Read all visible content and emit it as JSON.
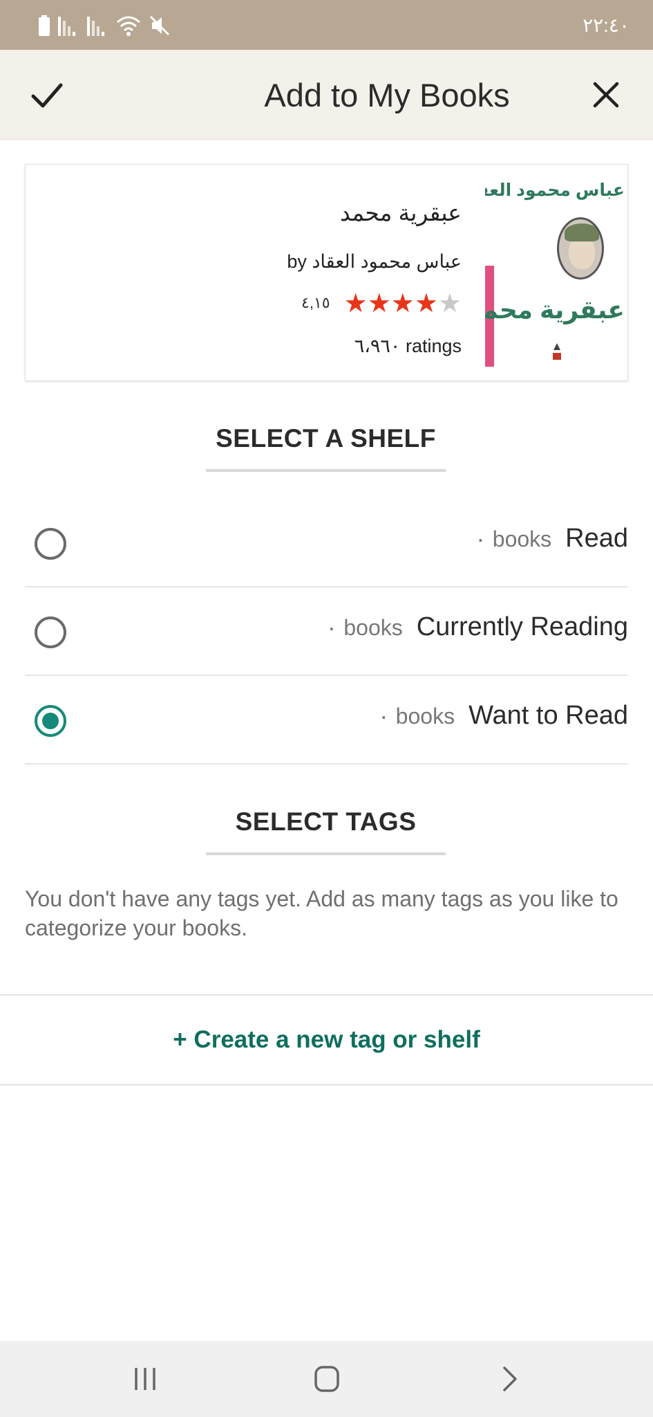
{
  "status_bar": {
    "time": "٢٢:٤٠",
    "icons": [
      "battery-icon",
      "signal-icon",
      "signal-icon",
      "wifi-icon",
      "mute-icon"
    ]
  },
  "app_bar": {
    "title": "Add to My Books",
    "confirm_icon": "checkmark-icon",
    "close_icon": "close-icon"
  },
  "book": {
    "title": "عبقرية محمد",
    "author": "عباس محمود العقاد",
    "author_prefix": "by",
    "rating_value": "٤,١٥",
    "rating_stars": 4.15,
    "ratings_count": "٦،٩٦٠",
    "ratings_label": "ratings",
    "cover": {
      "author_text": "عباس محمود العقاد",
      "title_text": "عبقرية محمد",
      "accent_color": "#e04f7e",
      "text_color": "#2f7a5c"
    }
  },
  "shelf_section": {
    "heading": "SELECT A SHELF",
    "shelves": [
      {
        "name": "Read",
        "count": "٠",
        "unit": "books",
        "selected": false
      },
      {
        "name": "Currently Reading",
        "count": "٠",
        "unit": "books",
        "selected": false
      },
      {
        "name": "Want to Read",
        "count": "٠",
        "unit": "books",
        "selected": true
      }
    ]
  },
  "tags_section": {
    "heading": "SELECT TAGS",
    "description": "You don't have any tags yet. Add as many tags as you like to categorize your books."
  },
  "create_tag": {
    "label": "+ Create a new tag or shelf"
  },
  "colors": {
    "status_bar": "#b8a893",
    "app_bar": "#f4f1ea",
    "accent_green": "#168a7a",
    "link_green": "#0f6e5f",
    "star_red": "#e8351a"
  },
  "nav_bar": {
    "buttons": [
      "recent-apps-icon",
      "home-icon",
      "back-icon"
    ]
  }
}
